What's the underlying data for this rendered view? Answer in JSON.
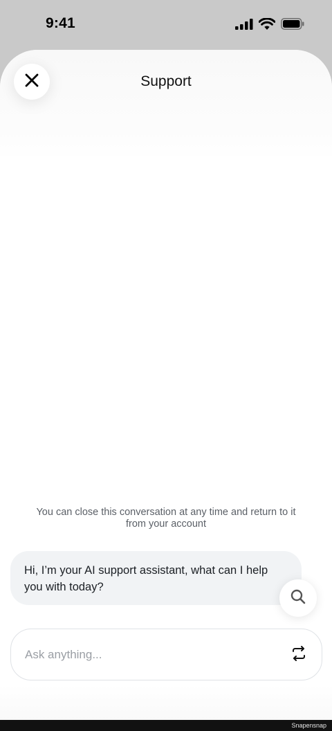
{
  "status_bar": {
    "time": "9:41",
    "icons": [
      "cellular-signal-icon",
      "wifi-icon",
      "battery-icon"
    ]
  },
  "header": {
    "title": "Support",
    "close_icon": "close-icon"
  },
  "conversation": {
    "notice": "You can close this conversation at any time and return to it from your account",
    "messages": [
      {
        "sender": "assistant",
        "text": "Hi, I’m your AI support assistant, what can I help you with today?"
      }
    ],
    "search_icon": "search-icon"
  },
  "composer": {
    "placeholder": "Ask anything...",
    "value": "",
    "action_icon": "swap-arrows-icon"
  },
  "footer": {
    "credit": "Snapensnap"
  },
  "colors": {
    "backdrop": "#c9c9c9",
    "sheet": "#ffffff",
    "bubble": "#f1f3f5",
    "muted_text": "#5a5f66",
    "placeholder": "#9a9ea4"
  }
}
